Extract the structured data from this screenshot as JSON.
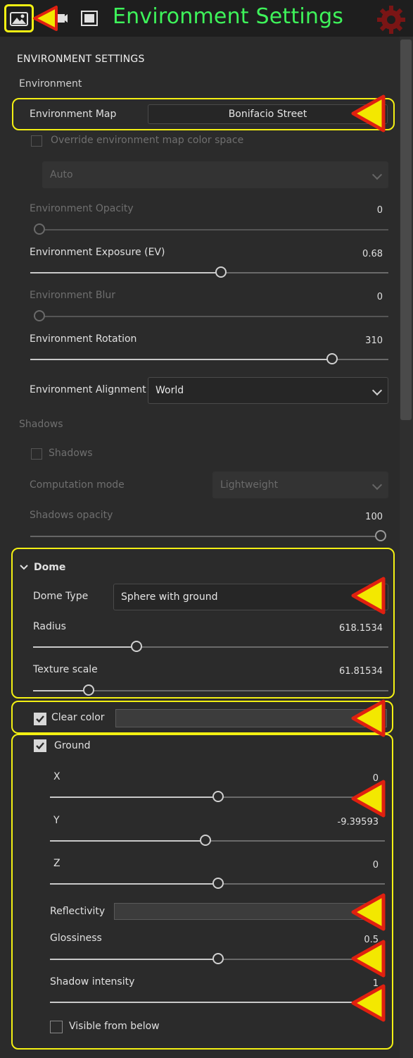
{
  "toolbar": {
    "title": "Environment Settings",
    "tools": [
      "environment-icon",
      "camera-icon",
      "frame-icon"
    ]
  },
  "panel": {
    "header": "ENVIRONMENT SETTINGS",
    "environment_section": "Environment",
    "env_map": {
      "label": "Environment Map",
      "value": "Bonifacio Street"
    },
    "override_colorspace": {
      "label": "Override environment map color space",
      "checked": false
    },
    "colorspace_select": "Auto",
    "opacity": {
      "label": "Environment Opacity",
      "value": "0",
      "fraction": 0.0
    },
    "exposure": {
      "label": "Environment Exposure (EV)",
      "value": "0.68",
      "fraction": 0.53
    },
    "blur": {
      "label": "Environment Blur",
      "value": "0",
      "fraction": 0.0
    },
    "rotation": {
      "label": "Environment Rotation",
      "value": "310",
      "fraction": 0.86
    },
    "alignment": {
      "label": "Environment Alignment",
      "value": "World"
    },
    "shadows_section": "Shadows",
    "shadows_checkbox": {
      "label": "Shadows",
      "checked": false
    },
    "computation_mode": {
      "label": "Computation mode",
      "value": "Lightweight"
    },
    "shadows_opacity": {
      "label": "Shadows opacity",
      "value": "100",
      "fraction": 1.0
    },
    "dome": {
      "title": "Dome",
      "type": {
        "label": "Dome Type",
        "value": "Sphere with ground"
      },
      "radius": {
        "label": "Radius",
        "value": "618.1534",
        "fraction": 0.29
      },
      "texture_scale": {
        "label": "Texture scale",
        "value": "61.81534",
        "fraction": 0.15
      }
    },
    "clear_color": {
      "label": "Clear color",
      "checked": true
    },
    "ground": {
      "label": "Ground",
      "checked": true,
      "x": {
        "label": "X",
        "value": "0",
        "fraction": 0.5
      },
      "y": {
        "label": "Y",
        "value": "-9.39593",
        "fraction": 0.46
      },
      "z": {
        "label": "Z",
        "value": "0",
        "fraction": 0.5
      },
      "reflectivity": {
        "label": "Reflectivity"
      },
      "glossiness": {
        "label": "Glossiness",
        "value": "0.5",
        "fraction": 0.5
      },
      "shadow_intensity": {
        "label": "Shadow intensity",
        "value": "1",
        "fraction": 1.0
      },
      "visible_from_below": {
        "label": "Visible from below",
        "checked": false
      }
    }
  },
  "colors": {
    "highlight": "#f3f013",
    "arrow_fill": "#f3e800",
    "arrow_stroke": "#e02010",
    "title_green": "#3ef35a"
  }
}
